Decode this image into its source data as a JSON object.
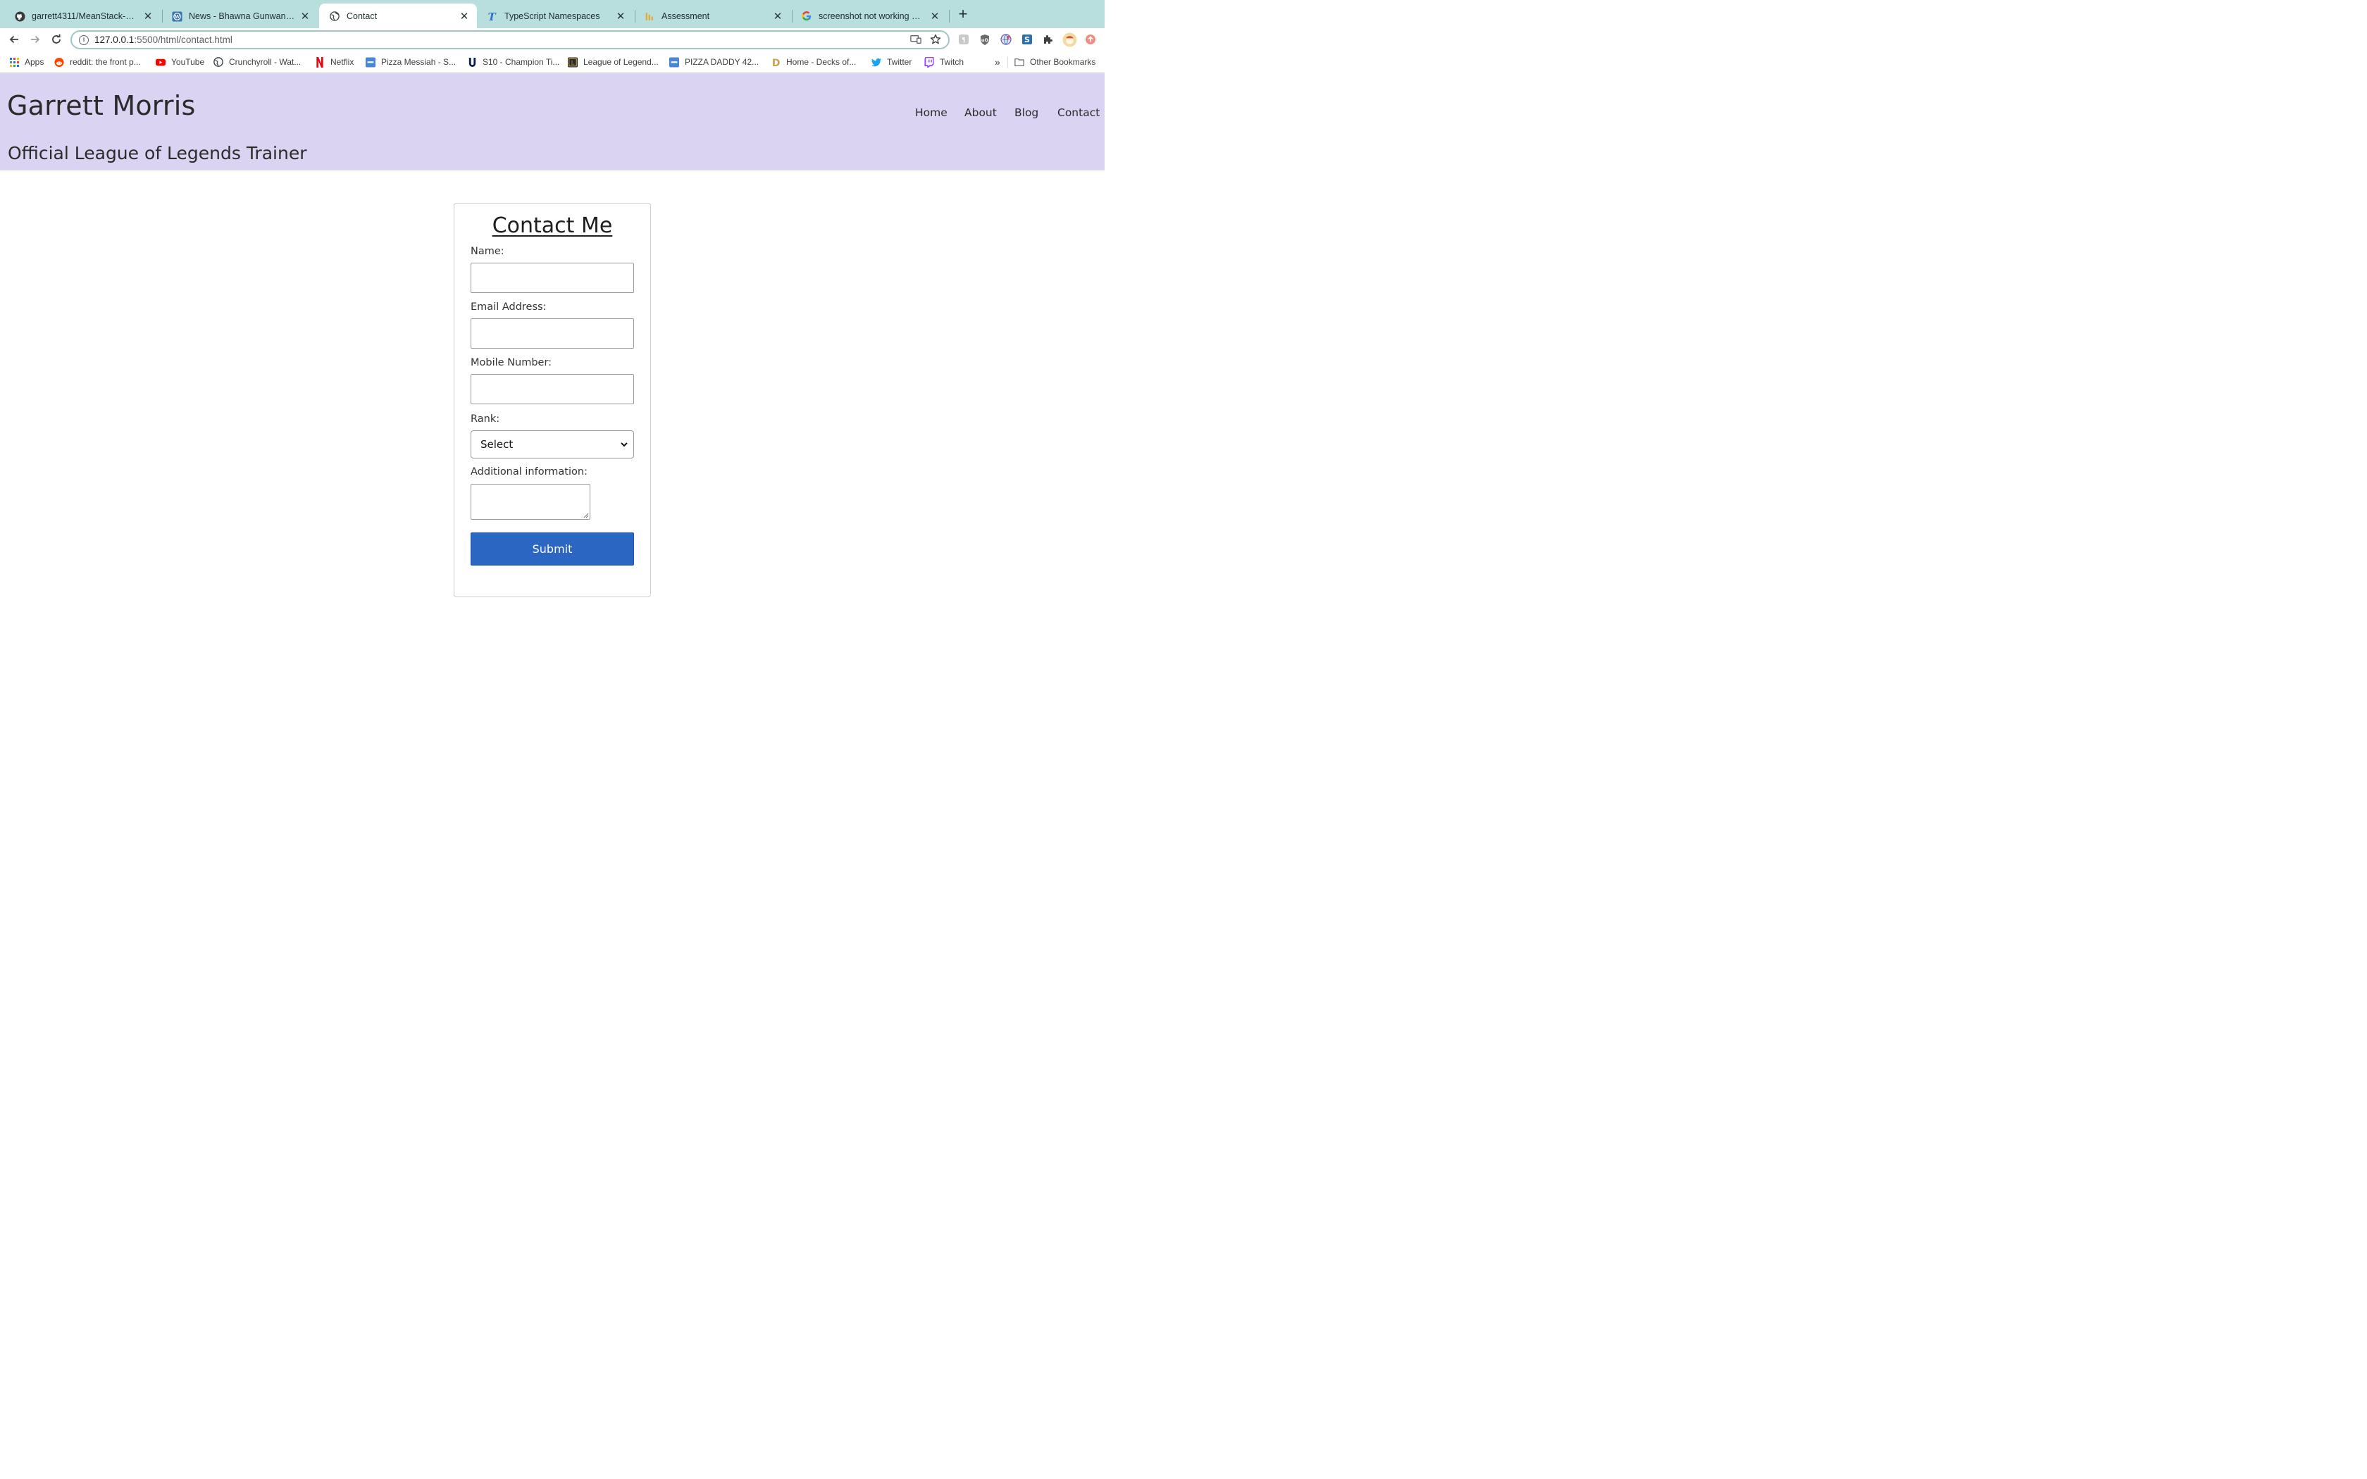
{
  "browser": {
    "tabs": [
      {
        "title": "garrett4311/MeanStack-Phase",
        "icon": "github-icon"
      },
      {
        "title": "News - Bhawna Gunwani Official",
        "icon": "wordpress-icon"
      },
      {
        "title": "Contact",
        "icon": "globe-icon",
        "active": true
      },
      {
        "title": "TypeScript Namespaces",
        "icon": "typescript-icon"
      },
      {
        "title": "Assessment",
        "icon": "assessment-icon"
      },
      {
        "title": "screenshot not working on mac",
        "icon": "google-icon"
      }
    ],
    "new_tab": "+",
    "close_glyph": "✕",
    "url_host": "127.0.0.1",
    "url_path": ":5500/html/contact.html",
    "bookmarks": [
      {
        "label": "Apps",
        "icon": "apps-grid-icon"
      },
      {
        "label": "reddit: the front p...",
        "icon": "reddit-icon"
      },
      {
        "label": "YouTube",
        "icon": "youtube-icon"
      },
      {
        "label": "Crunchyroll - Wat...",
        "icon": "crunchyroll-icon"
      },
      {
        "label": "Netflix",
        "icon": "netflix-icon"
      },
      {
        "label": "Pizza Messiah - S...",
        "icon": "menu-site-icon"
      },
      {
        "label": "S10 - Champion Ti...",
        "icon": "u-gg-icon"
      },
      {
        "label": "League of Legend...",
        "icon": "league-icon"
      },
      {
        "label": "PIZZA DADDY 42...",
        "icon": "menu-site-icon"
      },
      {
        "label": "Home - Decks of...",
        "icon": "decks-icon"
      },
      {
        "label": "Twitter",
        "icon": "twitter-icon"
      },
      {
        "label": "Twitch",
        "icon": "twitch-icon"
      }
    ],
    "more_bookmarks": "»",
    "other_bookmarks": "Other Bookmarks"
  },
  "site": {
    "title": "Garrett Morris",
    "subtitle": "Official League of Legends Trainer",
    "nav": [
      "Home",
      "About",
      "Blog",
      "Contact"
    ]
  },
  "form": {
    "heading": "Contact Me",
    "name_label": "Name:",
    "name_value": "",
    "email_label": "Email Address:",
    "email_value": "",
    "mobile_label": "Mobile Number:",
    "mobile_value": "",
    "rank_label": "Rank:",
    "rank_selected": "Select",
    "info_label": "Additional information:",
    "submit_label": "Submit"
  },
  "colors": {
    "tabstrip": "#b8dede",
    "header_bg": "#dad3f2",
    "submit_bg": "#2a66c2"
  }
}
